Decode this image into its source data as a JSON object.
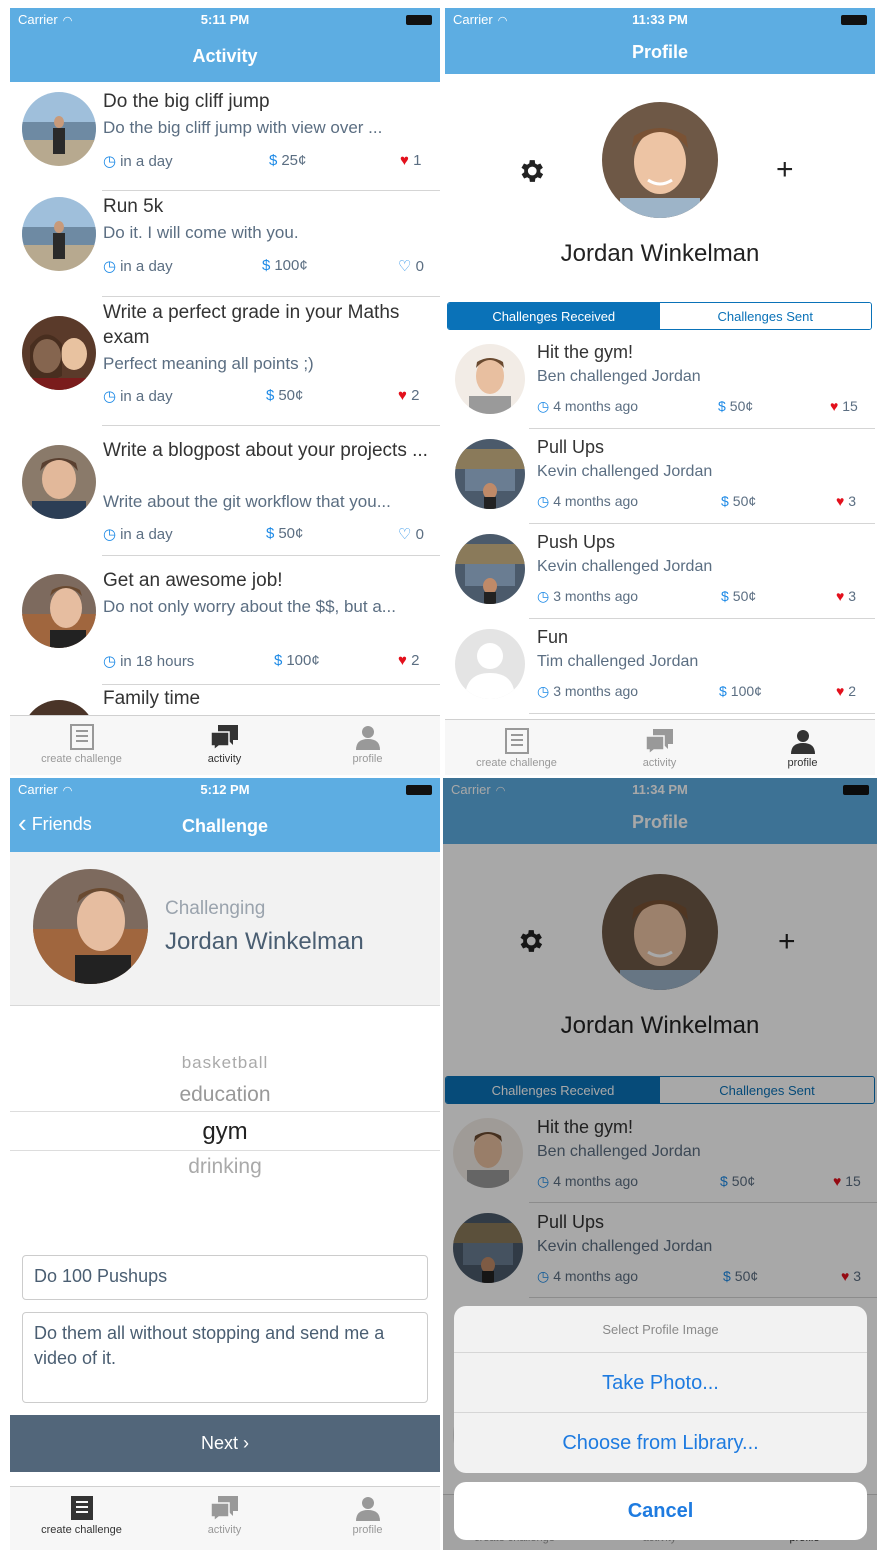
{
  "status1": {
    "carrier": "Carrier",
    "time": "5:11 PM"
  },
  "status2": {
    "carrier": "Carrier",
    "time": "11:33 PM"
  },
  "status3": {
    "carrier": "Carrier",
    "time": "5:12 PM"
  },
  "status4": {
    "carrier": "Carrier",
    "time": "11:34 PM"
  },
  "activity": {
    "title": "Activity",
    "items": [
      {
        "title": "Do the big cliff jump",
        "desc": "Do the big cliff jump with view over ...",
        "time": "in a day",
        "amount": "25¢",
        "likes": "1",
        "liked": true
      },
      {
        "title": "Run 5k",
        "desc": "Do it. I will come with you.",
        "time": "in a day",
        "amount": "100¢",
        "likes": "0",
        "liked": false
      },
      {
        "title": "Write a perfect grade in your Maths exam",
        "desc": "Perfect meaning all points ;)",
        "time": "in a day",
        "amount": "50¢",
        "likes": "2",
        "liked": true
      },
      {
        "title": "Write a blogpost about your projects ...",
        "desc": "Write about the git workflow that you...",
        "time": "in a day",
        "amount": "50¢",
        "likes": "0",
        "liked": false
      },
      {
        "title": "Get an awesome job!",
        "desc": "Do not only worry about the $$, but a...",
        "time": "in 18 hours",
        "amount": "100¢",
        "likes": "2",
        "liked": true
      },
      {
        "title": "Family time"
      }
    ]
  },
  "profile": {
    "title": "Profile",
    "name": "Jordan Winkelman",
    "seg_received": "Challenges Received",
    "seg_sent": "Challenges Sent",
    "items": [
      {
        "title": "Hit the gym!",
        "desc": "Ben challenged Jordan",
        "time": "4 months ago",
        "amount": "50¢",
        "likes": "15"
      },
      {
        "title": "Pull Ups",
        "desc": "Kevin challenged Jordan",
        "time": "4 months ago",
        "amount": "50¢",
        "likes": "3"
      },
      {
        "title": "Push Ups",
        "desc": "Kevin challenged Jordan",
        "time": "3 months ago",
        "amount": "50¢",
        "likes": "3"
      },
      {
        "title": "Fun",
        "desc": "Tim challenged Jordan",
        "time": "3 months ago",
        "amount": "100¢",
        "likes": "2"
      }
    ]
  },
  "challenge": {
    "back": "Friends",
    "title": "Challenge",
    "challenging_label": "Challenging",
    "name": "Jordan Winkelman",
    "picker": [
      "basketball",
      "education",
      "gym",
      "drinking"
    ],
    "title_value": "Do 100 Pushups",
    "desc_value": "Do them all without stopping and send me a video of it.",
    "next": "Next ›"
  },
  "sheet": {
    "title": "Select Profile Image",
    "take_photo": "Take Photo...",
    "choose_library": "Choose from Library...",
    "cancel": "Cancel"
  },
  "tabs": {
    "create": "create challenge",
    "activity": "activity",
    "profile": "profile"
  },
  "colors": {
    "navbar": "#5dade2",
    "accent": "#1e8ae6",
    "segment": "#0a72b8",
    "heart": "#e3101c",
    "next_button": "#52667a"
  }
}
